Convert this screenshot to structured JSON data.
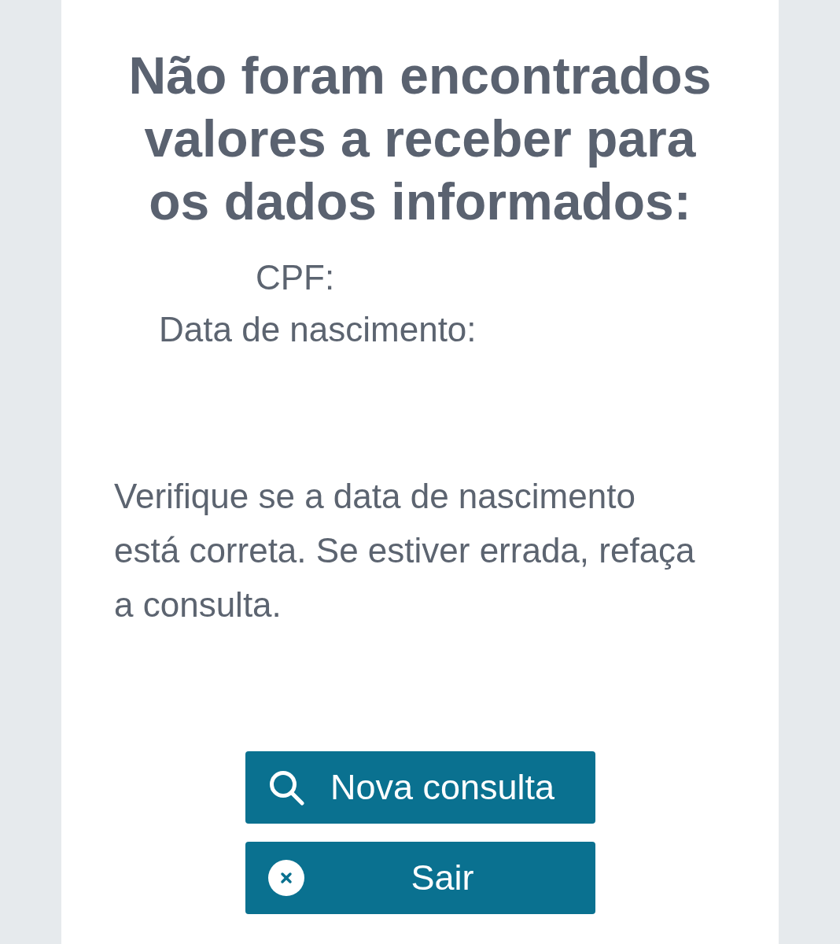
{
  "title": "Não foram encontrados valores a receber para os dados informados:",
  "fields": [
    {
      "label": "CPF:"
    },
    {
      "label": "Data de nascimento:"
    }
  ],
  "message": "Verifique se a data de nascimento está correta. Se estiver errada, refaça a consulta.",
  "buttons": [
    {
      "label": "Nova consulta",
      "kind": "search"
    },
    {
      "label": "Sair",
      "kind": "exit"
    }
  ]
}
